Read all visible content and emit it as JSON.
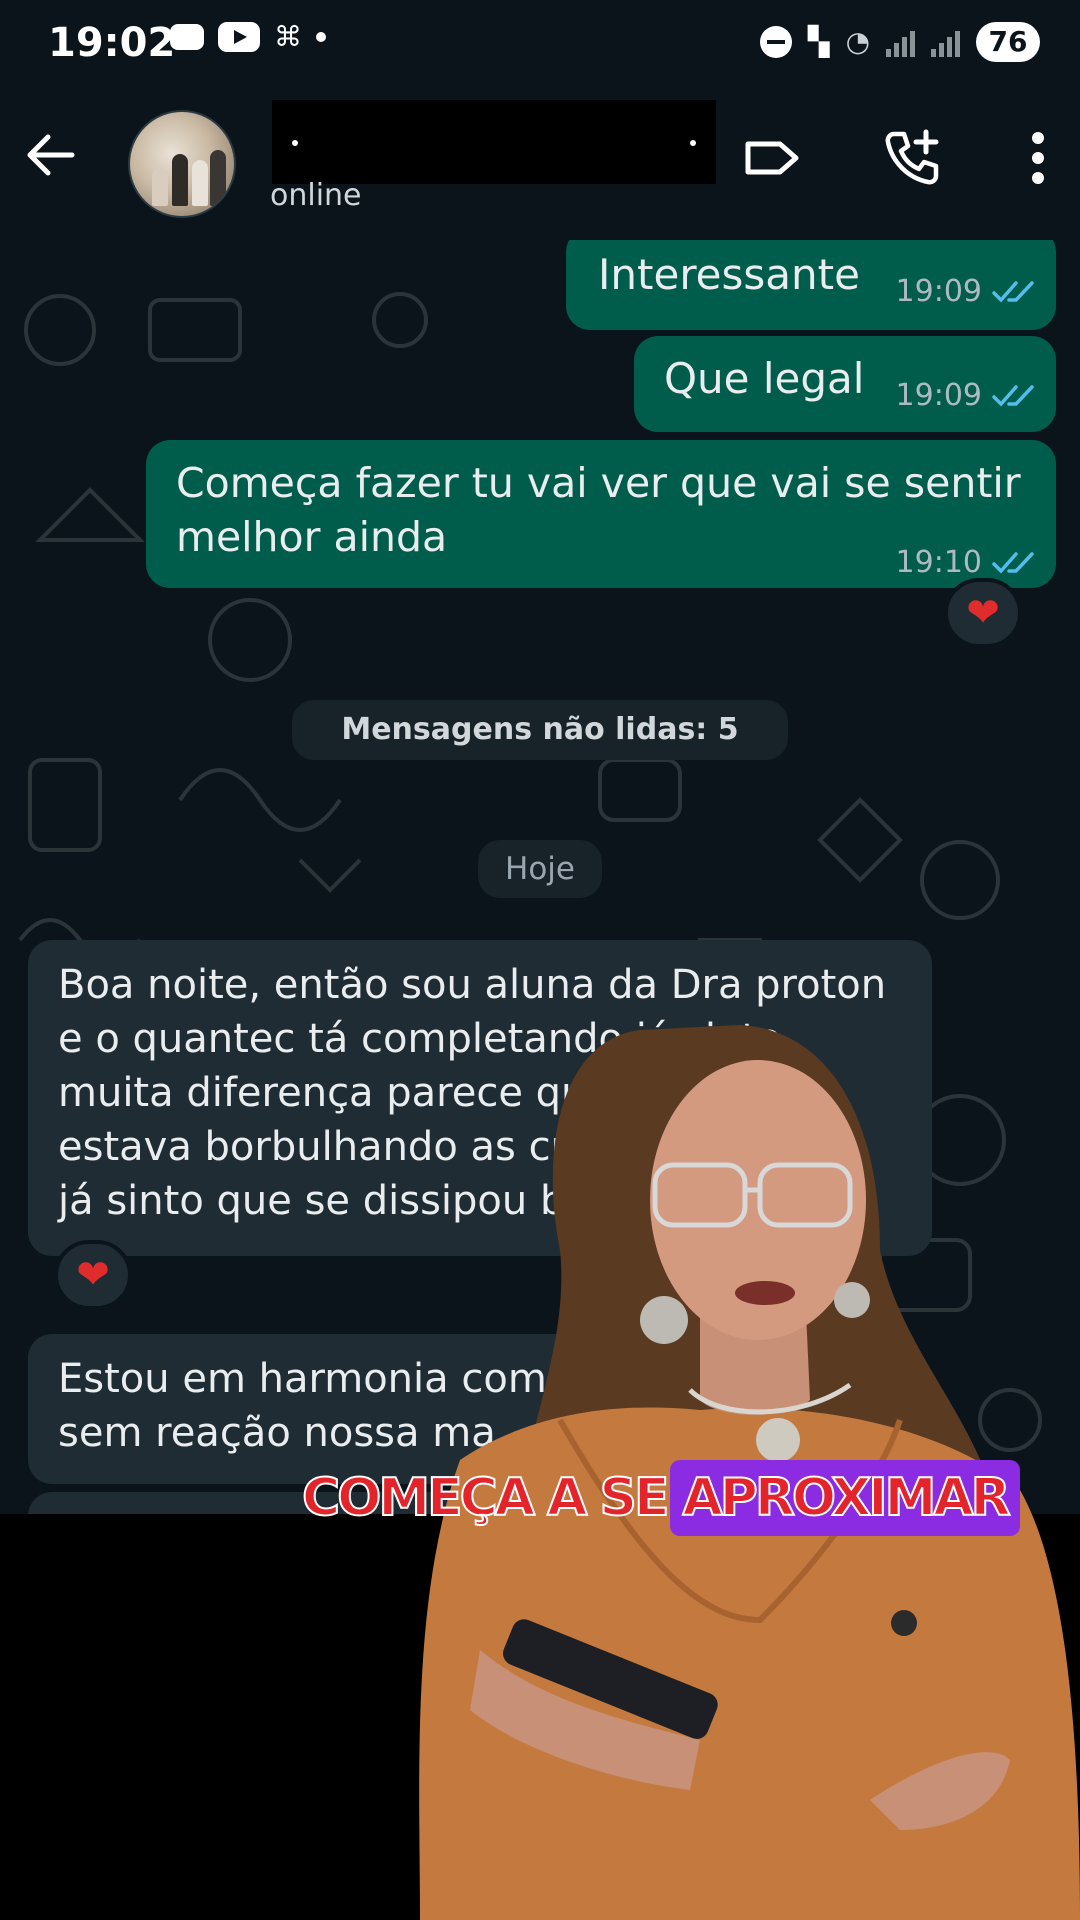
{
  "status_bar": {
    "time": "19:02",
    "battery": "76"
  },
  "header": {
    "contact_status": "online",
    "avatar": "group-photo",
    "icons": [
      "back-arrow-icon",
      "label-icon",
      "add-call-icon",
      "more-vert-icon"
    ]
  },
  "messages_out": [
    {
      "text": "Interessante",
      "time": "19:09"
    },
    {
      "text": "Que legal",
      "time": "19:09"
    },
    {
      "text": "Começa fazer tu vai ver que vai se sentir\nmelhor ainda",
      "time": "19:10",
      "reaction": "❤"
    }
  ],
  "system": {
    "unread": "Mensagens não lidas: 5",
    "date": "Hoje"
  },
  "messages_in": [
    {
      "text": "Boa noite, então sou aluna da Dra proton\ne o quantec tá completando já sinto\nmuita diferença parece que\nestava borbulhando as cre\njá sinto que se dissipou ba",
      "reaction": "❤"
    },
    {
      "text": "Estou em harmonia com\nsem reação nossa ma"
    }
  ],
  "caption": {
    "part1": "COMEÇA A SE",
    "part2": "APROXIMAR"
  },
  "colors": {
    "chat_bg": "#0b141a",
    "outgoing_bubble": "#005c4b",
    "incoming_bubble": "#202c33",
    "read_ticks": "#53bdeb",
    "caption_text": "#e3242b",
    "caption_highlight": "#8b2be2"
  }
}
